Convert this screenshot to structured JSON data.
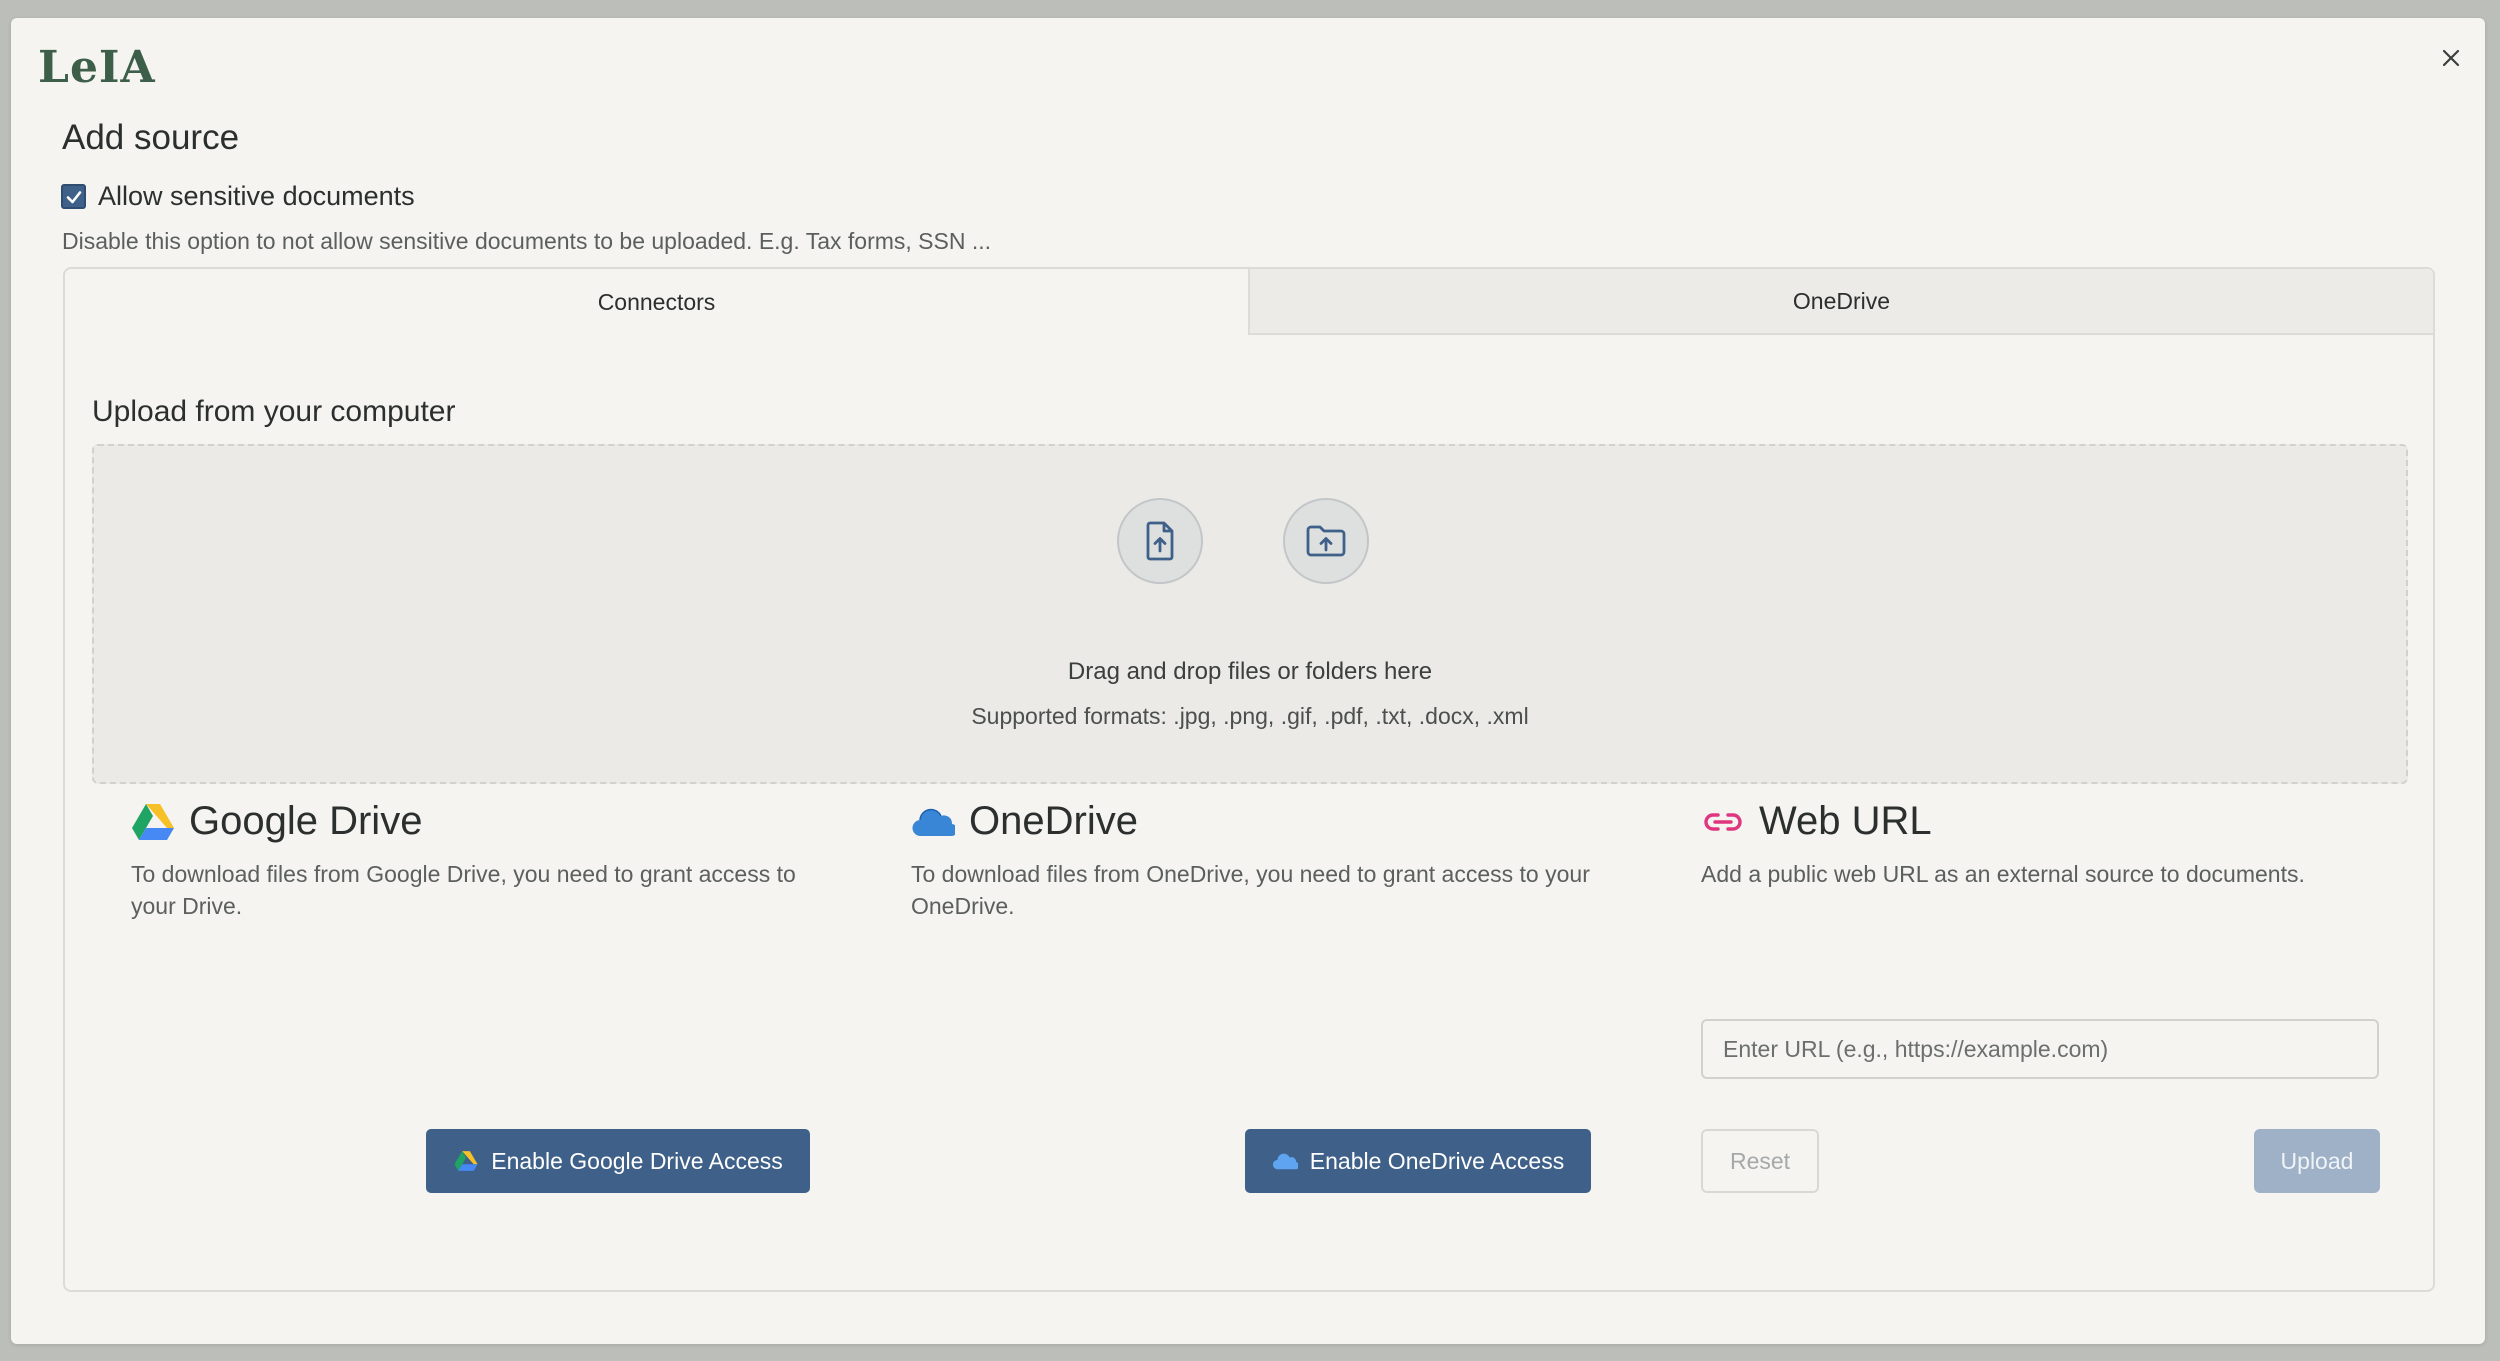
{
  "app": {
    "logo": "LeIA"
  },
  "dialog": {
    "title": "Add source",
    "sensitive": {
      "label": "Allow sensitive documents",
      "checked": true,
      "hint": "Disable this option to not allow sensitive documents to be uploaded. E.g. Tax forms, SSN ..."
    }
  },
  "tabs": [
    {
      "label": "Connectors",
      "active": true
    },
    {
      "label": "OneDrive",
      "active": false
    }
  ],
  "upload": {
    "title": "Upload from your computer",
    "drop_text": "Drag and drop files or folders here",
    "formats": "Supported formats: .jpg, .png, .gif, .pdf, .txt, .docx, .xml"
  },
  "connectors": {
    "google_drive": {
      "title": "Google Drive",
      "description": "To download files from Google Drive, you need to grant access to your Drive.",
      "button": "Enable Google Drive Access"
    },
    "onedrive": {
      "title": "OneDrive",
      "description": "To download files from OneDrive, you need to grant access to your OneDrive.",
      "button": "Enable OneDrive Access"
    },
    "web_url": {
      "title": "Web URL",
      "description": "Add a public web URL as an external source to documents.",
      "placeholder": "Enter URL (e.g., https://example.com)",
      "value": "",
      "reset": "Reset",
      "upload": "Upload"
    }
  },
  "icons": {
    "close": "close-icon",
    "file_upload": "file-upload-icon",
    "folder_upload": "folder-upload-icon",
    "google_drive": "google-drive-icon",
    "onedrive": "onedrive-cloud-icon",
    "link": "link-icon"
  },
  "colors": {
    "primary": "#3f6088",
    "primary_disabled": "#9eb1c6",
    "logo": "#3d5f4a",
    "link_icon": "#e0367f",
    "onedrive": "#3a86d6"
  }
}
